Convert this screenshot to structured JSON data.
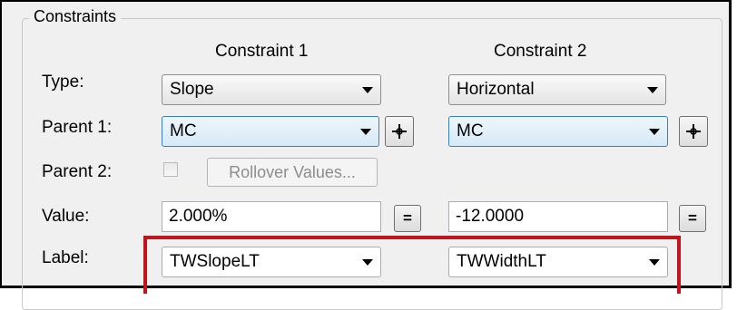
{
  "group_title": "Constraints",
  "columns": {
    "c1": "Constraint 1",
    "c2": "Constraint 2"
  },
  "labels": {
    "type": "Type:",
    "parent1": "Parent 1:",
    "parent2": "Parent 2:",
    "value": "Value:",
    "label": "Label:"
  },
  "constraint1": {
    "type": "Slope",
    "parent1": "MC",
    "value": "2.000%",
    "label": "TWSlopeLT"
  },
  "constraint2": {
    "type": "Horizontal",
    "parent1": "MC",
    "value": "-12.0000",
    "label": "TWWidthLT"
  },
  "parent2": {
    "checked": false,
    "button_label": "Rollover Values..."
  },
  "equals_label": "=",
  "highlight_color": "#c0151b",
  "icons": {
    "dropdown": "chevron-down-icon",
    "pick": "crosshair-icon"
  }
}
